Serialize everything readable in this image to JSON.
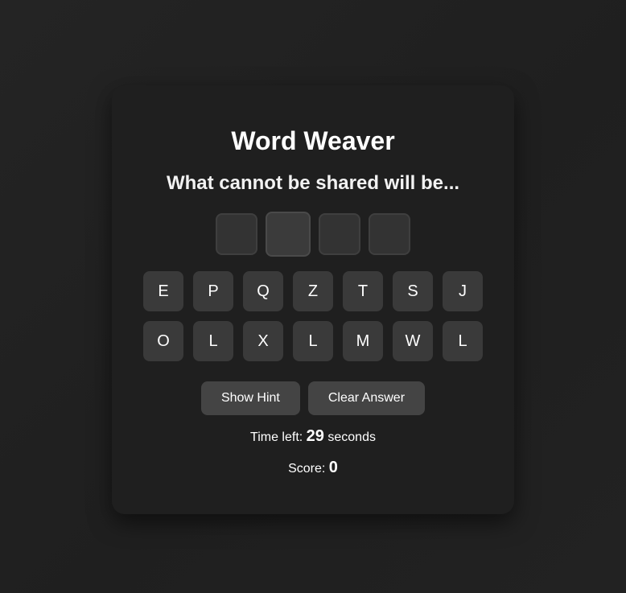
{
  "game": {
    "title": "Word Weaver",
    "prompt": "What cannot be shared will be...",
    "answer_slot_count": 4,
    "letters": [
      "E",
      "P",
      "Q",
      "Z",
      "T",
      "S",
      "J",
      "O",
      "L",
      "X",
      "L",
      "M",
      "W",
      "L"
    ]
  },
  "buttons": {
    "hint_label": "Show Hint",
    "clear_label": "Clear Answer"
  },
  "timer": {
    "prefix": "Time left:",
    "value": "29",
    "suffix": "seconds"
  },
  "score": {
    "prefix": "Score:",
    "value": "0"
  },
  "colors": {
    "background": "#222222",
    "card": "#1f1f1f",
    "tile": "#3a3a3a",
    "slot": "#333333",
    "button": "#444444",
    "text": "#ffffff"
  }
}
